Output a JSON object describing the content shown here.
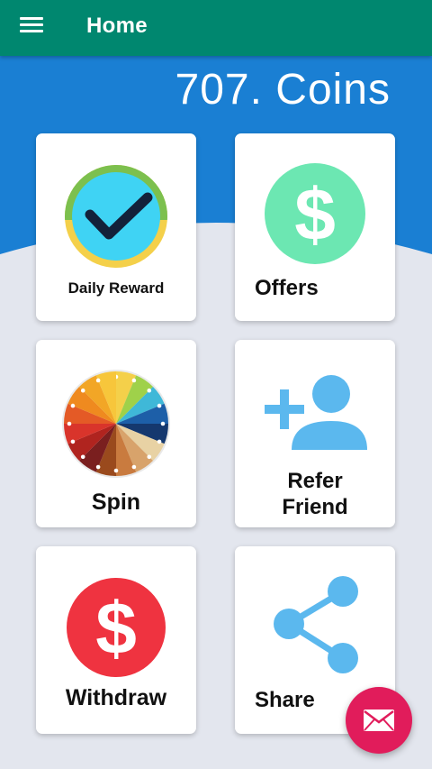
{
  "appbar": {
    "title": "Home",
    "menu_icon": "hamburger-menu-icon"
  },
  "header": {
    "coins_text": "707. Coins"
  },
  "colors": {
    "appbar": "#00876f",
    "hero": "#1a7fd3",
    "page_bg": "#e3e6ee",
    "fab": "#e11c5b"
  },
  "cards": [
    {
      "label": "Daily Reward",
      "icon": "checkmark-clock-icon"
    },
    {
      "label": "Offers",
      "icon": "dollar-circle-icon"
    },
    {
      "label": "Spin",
      "icon": "spin-wheel-icon"
    },
    {
      "label": "Refer Friend",
      "icon": "add-user-icon"
    },
    {
      "label": "Withdraw",
      "icon": "dollar-circle-red-icon"
    },
    {
      "label": "Share",
      "icon": "share-icon"
    }
  ],
  "fab": {
    "icon": "mail-icon"
  }
}
